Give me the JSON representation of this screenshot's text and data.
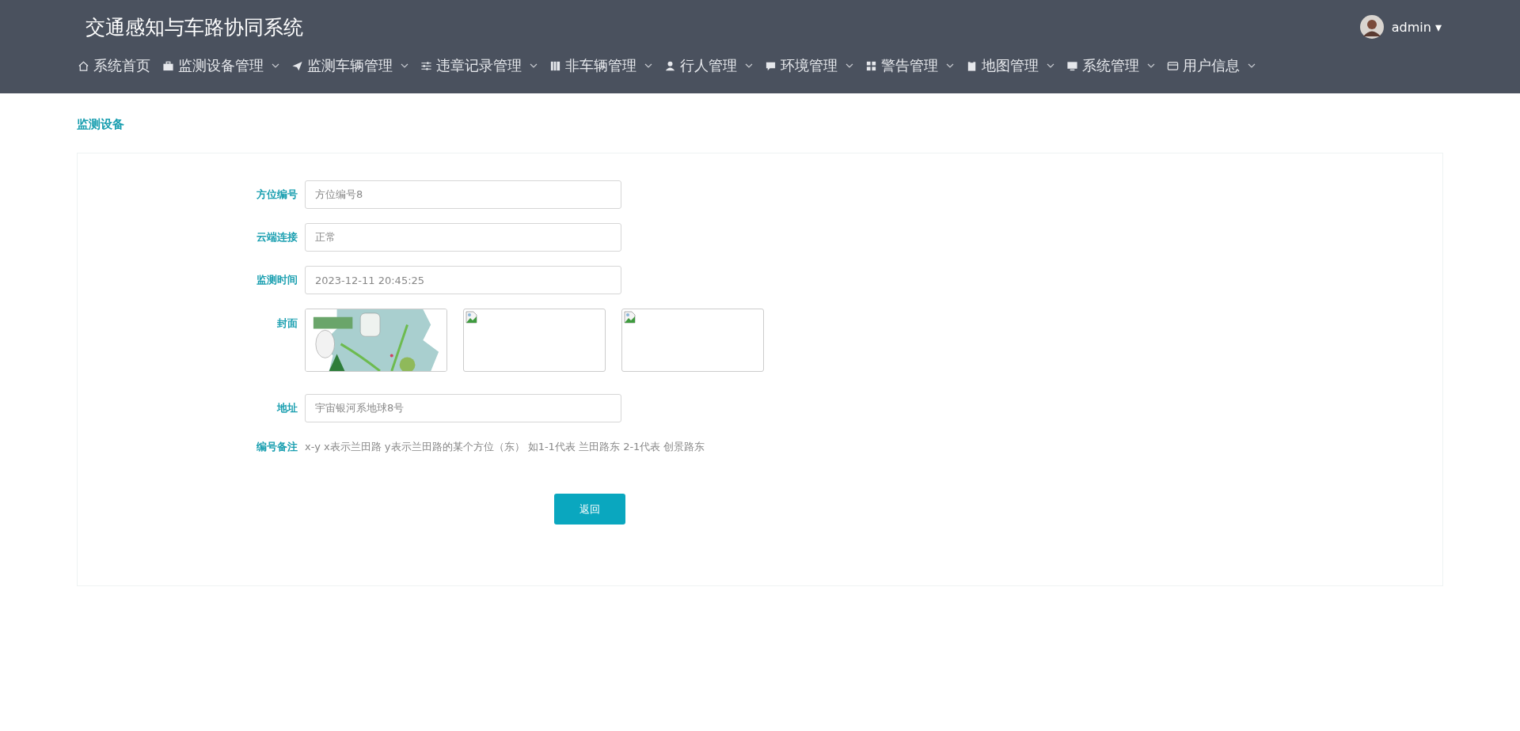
{
  "header": {
    "title": "交通感知与车路协同系统",
    "user": "admin",
    "caret": "▾"
  },
  "nav": [
    {
      "label": "系统首页",
      "dropdown": false
    },
    {
      "label": "监测设备管理",
      "dropdown": true
    },
    {
      "label": "监测车辆管理",
      "dropdown": true
    },
    {
      "label": "违章记录管理",
      "dropdown": true
    },
    {
      "label": "非车辆管理",
      "dropdown": true
    },
    {
      "label": "行人管理",
      "dropdown": true
    },
    {
      "label": "环境管理",
      "dropdown": true
    },
    {
      "label": "警告管理",
      "dropdown": true
    },
    {
      "label": "地图管理",
      "dropdown": true
    },
    {
      "label": "系统管理",
      "dropdown": true
    },
    {
      "label": "用户信息",
      "dropdown": true
    }
  ],
  "breadcrumb": "监测设备",
  "form": {
    "fields": [
      {
        "kind": "input",
        "label": "方位编号",
        "value": "方位编号8"
      },
      {
        "kind": "input",
        "label": "云端连接",
        "value": "正常"
      },
      {
        "kind": "input",
        "label": "监测时间",
        "value": "2023-12-11 20:45:25"
      },
      {
        "kind": "images",
        "label": "封面",
        "images": [
          {
            "kind": "picture"
          },
          {
            "kind": "broken"
          },
          {
            "kind": "broken"
          }
        ]
      },
      {
        "kind": "input",
        "label": "地址",
        "value": "宇宙银河系地球8号"
      },
      {
        "kind": "text",
        "label": "编号备注",
        "value": "x-y x表示兰田路 y表示兰田路的某个方位（东） 如1-1代表 兰田路东 2-1代表 创景路东"
      }
    ],
    "button": "返回"
  }
}
